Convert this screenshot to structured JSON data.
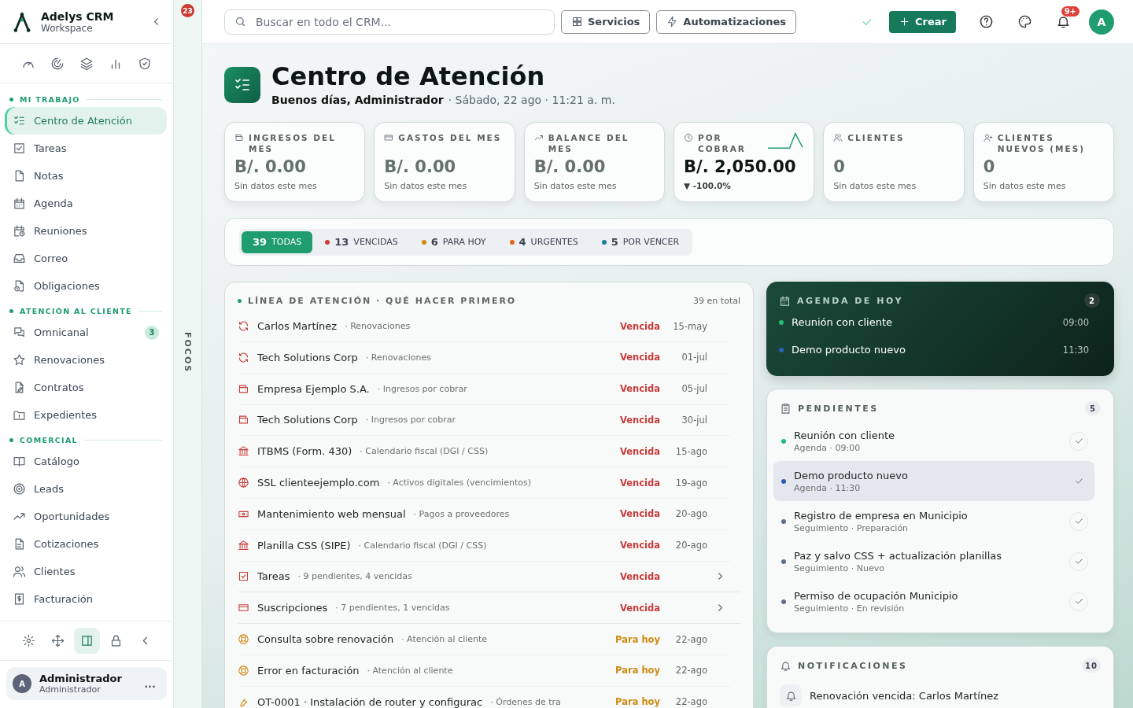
{
  "brand": {
    "name": "Adelys CRM",
    "subtitle": "Workspace"
  },
  "sidebar": {
    "sections": [
      {
        "title": "MI TRABAJO",
        "items": [
          {
            "label": "Centro de Atención",
            "selected": true
          },
          {
            "label": "Tareas",
            "selected": false
          },
          {
            "label": "Notas",
            "selected": false
          },
          {
            "label": "Agenda",
            "selected": false
          },
          {
            "label": "Reuniones",
            "selected": false
          },
          {
            "label": "Correo",
            "selected": false
          },
          {
            "label": "Obligaciones",
            "selected": false
          }
        ]
      },
      {
        "title": "ATENCIÓN AL CLIENTE",
        "items": [
          {
            "label": "Omnicanal",
            "selected": false,
            "badge": "3"
          },
          {
            "label": "Renovaciones",
            "selected": false
          },
          {
            "label": "Contratos",
            "selected": false
          },
          {
            "label": "Expedientes",
            "selected": false
          }
        ]
      },
      {
        "title": "COMERCIAL",
        "items": [
          {
            "label": "Catálogo",
            "selected": false
          },
          {
            "label": "Leads",
            "selected": false
          },
          {
            "label": "Oportunidades",
            "selected": false
          },
          {
            "label": "Cotizaciones",
            "selected": false
          },
          {
            "label": "Clientes",
            "selected": false
          },
          {
            "label": "Facturación",
            "selected": false
          }
        ]
      }
    ],
    "bottom_tools": [
      {
        "selected": false
      },
      {
        "selected": false
      },
      {
        "selected": true
      },
      {
        "selected": false
      },
      {
        "selected": false
      }
    ],
    "user": {
      "initial": "A",
      "name": "Administrador",
      "role": "Administrador",
      "menu": "..."
    }
  },
  "focus_strip": {
    "badge": "23",
    "label": "FOCOS"
  },
  "topbar": {
    "search": {
      "placeholder": "Buscar en todo el CRM..."
    },
    "buttons": [
      "Servicios",
      "Automatizaciones"
    ],
    "create": "Crear",
    "notification_badge": "9+",
    "avatar": "A"
  },
  "header": {
    "title": "Centro de Atención",
    "greeting": "Buenos días, Administrador",
    "date": "· Sábado, 22 ago · 11:21 a. m."
  },
  "kpis": [
    {
      "label": "INGRESOS DEL MES",
      "value": "B/. 0.00",
      "note": "Sin datos este mes",
      "highlighted": false
    },
    {
      "label": "GASTOS DEL MES",
      "value": "B/. 0.00",
      "note": "Sin datos este mes",
      "highlighted": false
    },
    {
      "label": "BALANCE DEL MES",
      "value": "B/. 0.00",
      "note": "Sin datos este mes",
      "highlighted": false
    },
    {
      "label": "POR COBRAR",
      "value": "B/. 2,050.00",
      "change": "▼ -100.0%",
      "highlighted": true
    },
    {
      "label": "CLIENTES",
      "value": "0",
      "note": "Sin datos este mes",
      "highlighted": false
    },
    {
      "label": "CLIENTES NUEVOS (MES)",
      "value": "0",
      "note": "Sin datos este mes",
      "highlighted": false
    }
  ],
  "filters": [
    {
      "count": "39",
      "label": "TODAS",
      "selected": true
    },
    {
      "count": "13",
      "label": "VENCIDAS",
      "color": "#d03a3a",
      "selected": false
    },
    {
      "count": "6",
      "label": "PARA HOY",
      "color": "#d08a12",
      "selected": false
    },
    {
      "count": "4",
      "label": "URGENTES",
      "color": "#e0661c",
      "selected": false
    },
    {
      "count": "5",
      "label": "POR VENCER",
      "color": "#1a7fa0",
      "selected": false
    }
  ],
  "queue": {
    "title": "LÍNEA DE ATENCIÓN · QUÉ HACER PRIMERO",
    "total": "39 en total",
    "rows": [
      {
        "kind": "renewal",
        "title": "Carlos Martínez",
        "category": "· Renovaciones",
        "status": "Vencida",
        "overdue": true,
        "date": "15-may",
        "expandable": false
      },
      {
        "kind": "renewal",
        "title": "Tech Solutions Corp",
        "category": "· Renovaciones",
        "status": "Vencida",
        "overdue": true,
        "date": "01-jul",
        "expandable": false
      },
      {
        "kind": "receivable",
        "title": "Empresa Ejemplo S.A.",
        "category": "· Ingresos por cobrar",
        "status": "Vencida",
        "overdue": true,
        "date": "05-jul",
        "expandable": false
      },
      {
        "kind": "receivable",
        "title": "Tech Solutions Corp",
        "category": "· Ingresos por cobrar",
        "status": "Vencida",
        "overdue": true,
        "date": "30-jul",
        "expandable": false
      },
      {
        "kind": "fiscal",
        "title": "ITBMS (Form. 430)",
        "category": "· Calendario fiscal (DGI / CSS)",
        "status": "Vencida",
        "overdue": true,
        "date": "15-ago",
        "expandable": false
      },
      {
        "kind": "digital",
        "title": "SSL clienteejemplo.com",
        "category": "· Activos digitales (vencimientos)",
        "status": "Vencida",
        "overdue": true,
        "date": "19-ago",
        "expandable": false
      },
      {
        "kind": "payment",
        "title": "Mantenimiento web mensual",
        "category": "· Pagos a proveedores",
        "status": "Vencida",
        "overdue": true,
        "date": "20-ago",
        "expandable": false
      },
      {
        "kind": "fiscal",
        "title": "Planilla CSS (SIPE)",
        "category": "· Calendario fiscal (DGI / CSS)",
        "status": "Vencida",
        "overdue": true,
        "date": "20-ago",
        "expandable": false
      },
      {
        "kind": "task",
        "title": "Tareas",
        "category": "· 9 pendientes, 4 vencidas",
        "status": "Vencida",
        "overdue": true,
        "expandable": true
      },
      {
        "kind": "subscription",
        "title": "Suscripciones",
        "category": "· 7 pendientes, 1 vencidas",
        "status": "Vencida",
        "overdue": true,
        "expandable": true
      },
      {
        "kind": "support",
        "title": "Consulta sobre renovación",
        "category": "· Atención al cliente",
        "status": "Para hoy",
        "overdue": false,
        "date": "22-ago",
        "expandable": false
      },
      {
        "kind": "support",
        "title": "Error en facturación",
        "category": "· Atención al cliente",
        "status": "Para hoy",
        "overdue": false,
        "date": "22-ago",
        "expandable": false
      },
      {
        "kind": "work_order",
        "title": "OT-0001 · Instalación de router y configurac",
        "category": "· Órdenes de tra",
        "status": "Para hoy",
        "overdue": false,
        "date": "22-ago",
        "expandable": false
      }
    ]
  },
  "agenda": {
    "title": "AGENDA DE HOY",
    "count": "2",
    "items": [
      {
        "title": "Reunión con cliente",
        "time": "09:00",
        "color": "#22c07a"
      },
      {
        "title": "Demo producto nuevo",
        "time": "11:30",
        "color": "#2a62b8"
      }
    ]
  },
  "pending": {
    "title": "PENDIENTES",
    "count": "5",
    "items": [
      {
        "title": "Reunión con cliente",
        "meta": "Agenda · 09:00",
        "color": "#1fbf7a",
        "selected": false
      },
      {
        "title": "Demo producto nuevo",
        "meta": "Agenda · 11:30",
        "color": "#2a5fb0",
        "selected": true
      },
      {
        "title": "Registro de empresa en Municipio",
        "meta": "Seguimiento · Preparación",
        "color": "#5f6f8e",
        "selected": false
      },
      {
        "title": "Paz y salvo CSS + actualización planillas",
        "meta": "Seguimiento · Nuevo",
        "color": "#5f6f8e",
        "selected": false
      },
      {
        "title": "Permiso de ocupación Municipio",
        "meta": "Seguimiento · En revisión",
        "color": "#5f6f8e",
        "selected": false
      }
    ]
  },
  "notifications": {
    "title": "NOTIFICACIONES",
    "count": "10",
    "items": [
      {
        "title": "Renovación vencida: Carlos Martínez"
      }
    ]
  }
}
